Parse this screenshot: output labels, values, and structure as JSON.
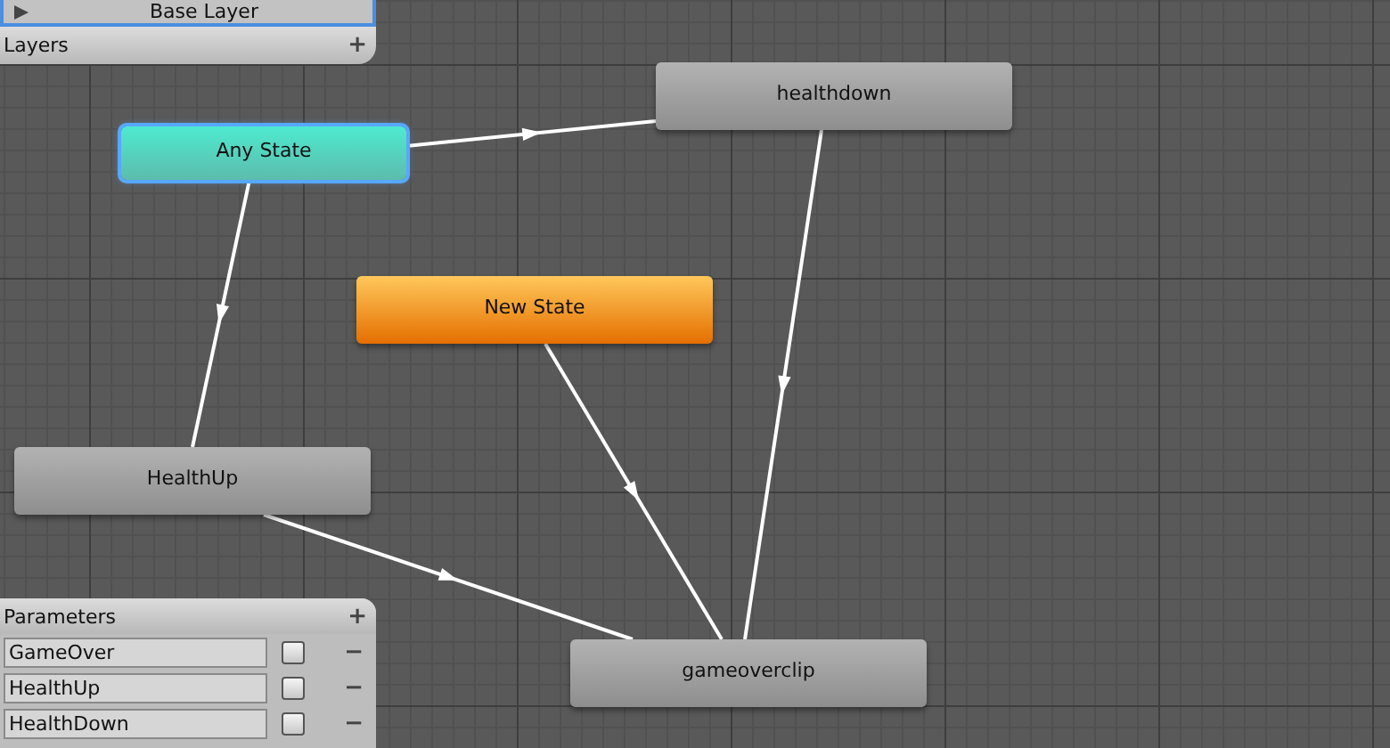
{
  "layers_panel": {
    "layer": "Base Layer",
    "title": "Layers",
    "add": "+"
  },
  "states": [
    {
      "name": "Any State",
      "kind": "any",
      "selected": true
    },
    {
      "name": "healthdown",
      "kind": "normal",
      "selected": false
    },
    {
      "name": "New State",
      "kind": "default",
      "selected": false
    },
    {
      "name": "HealthUp",
      "kind": "normal",
      "selected": false
    },
    {
      "name": "gameoverclip",
      "kind": "normal",
      "selected": false
    }
  ],
  "parameters_panel": {
    "title": "Parameters",
    "add": "+",
    "parameters": [
      {
        "name": "GameOver",
        "checked": false,
        "remove": "−"
      },
      {
        "name": "HealthUp",
        "checked": false,
        "remove": "−"
      },
      {
        "name": "HealthDown",
        "checked": false,
        "remove": "−"
      }
    ]
  }
}
